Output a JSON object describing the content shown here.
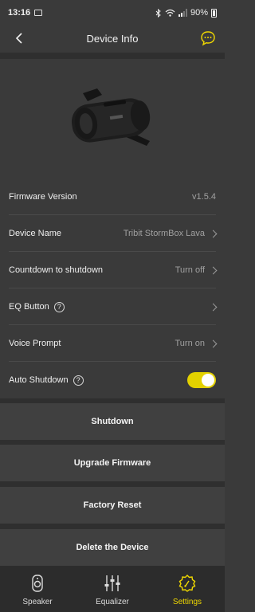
{
  "status": {
    "time": "13:16",
    "battery": "90%"
  },
  "header": {
    "title": "Device Info"
  },
  "rows": {
    "firmware": {
      "label": "Firmware Version",
      "value": "v1.5.4"
    },
    "device_name": {
      "label": "Device Name",
      "value": "Tribit StormBox Lava"
    },
    "countdown": {
      "label": "Countdown to shutdown",
      "value": "Turn off"
    },
    "eq_button": {
      "label": "EQ Button",
      "help": "?"
    },
    "voice_prompt": {
      "label": "Voice Prompt",
      "value": "Turn on"
    },
    "auto_shutdown": {
      "label": "Auto Shutdown",
      "help": "?",
      "enabled": true
    }
  },
  "buttons": {
    "shutdown": "Shutdown",
    "upgrade": "Upgrade Firmware",
    "factory_reset": "Factory Reset",
    "delete": "Delete the Device"
  },
  "tabs": [
    {
      "label": "Speaker",
      "icon": "speaker-icon"
    },
    {
      "label": "Equalizer",
      "icon": "equalizer-icon"
    },
    {
      "label": "Settings",
      "icon": "settings-icon",
      "active": true
    }
  ],
  "colors": {
    "accent": "#e3d100",
    "background": "#3a3a3a",
    "band": "#2f2f2f"
  }
}
